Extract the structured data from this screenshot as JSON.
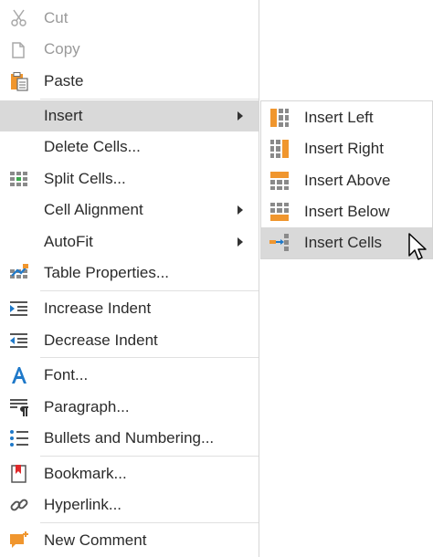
{
  "context_menu": {
    "items": [
      {
        "label": "Cut",
        "icon": "scissors-icon",
        "disabled": true
      },
      {
        "label": "Copy",
        "icon": "copy-icon",
        "disabled": true
      },
      {
        "label": "Paste",
        "icon": "paste-icon"
      },
      {
        "label": "Insert",
        "submenu": true,
        "highlighted": true
      },
      {
        "label": "Delete Cells..."
      },
      {
        "label": "Split Cells...",
        "icon": "split-cells-icon"
      },
      {
        "label": "Cell Alignment",
        "submenu": true
      },
      {
        "label": "AutoFit",
        "submenu": true
      },
      {
        "label": "Table Properties...",
        "icon": "table-properties-icon"
      },
      {
        "label": "Increase Indent",
        "icon": "increase-indent-icon"
      },
      {
        "label": "Decrease Indent",
        "icon": "decrease-indent-icon"
      },
      {
        "label": "Font...",
        "icon": "font-icon"
      },
      {
        "label": "Paragraph...",
        "icon": "paragraph-icon"
      },
      {
        "label": "Bullets and Numbering...",
        "icon": "bullets-icon"
      },
      {
        "label": "Bookmark...",
        "icon": "bookmark-icon"
      },
      {
        "label": "Hyperlink...",
        "icon": "hyperlink-icon"
      },
      {
        "label": "New Comment",
        "icon": "new-comment-icon"
      }
    ]
  },
  "insert_submenu": {
    "items": [
      {
        "label": "Insert Left",
        "icon": "insert-left-icon"
      },
      {
        "label": "Insert Right",
        "icon": "insert-right-icon"
      },
      {
        "label": "Insert Above",
        "icon": "insert-above-icon"
      },
      {
        "label": "Insert Below",
        "icon": "insert-below-icon"
      },
      {
        "label": "Insert Cells",
        "icon": "insert-cells-icon",
        "highlighted": true
      }
    ]
  },
  "colors": {
    "accent_orange": "#f0962e",
    "icon_gray": "#6d6d6d",
    "icon_blue": "#1f79c9",
    "highlight": "#d9d9d9",
    "disabled_text": "#9a9a9a"
  }
}
